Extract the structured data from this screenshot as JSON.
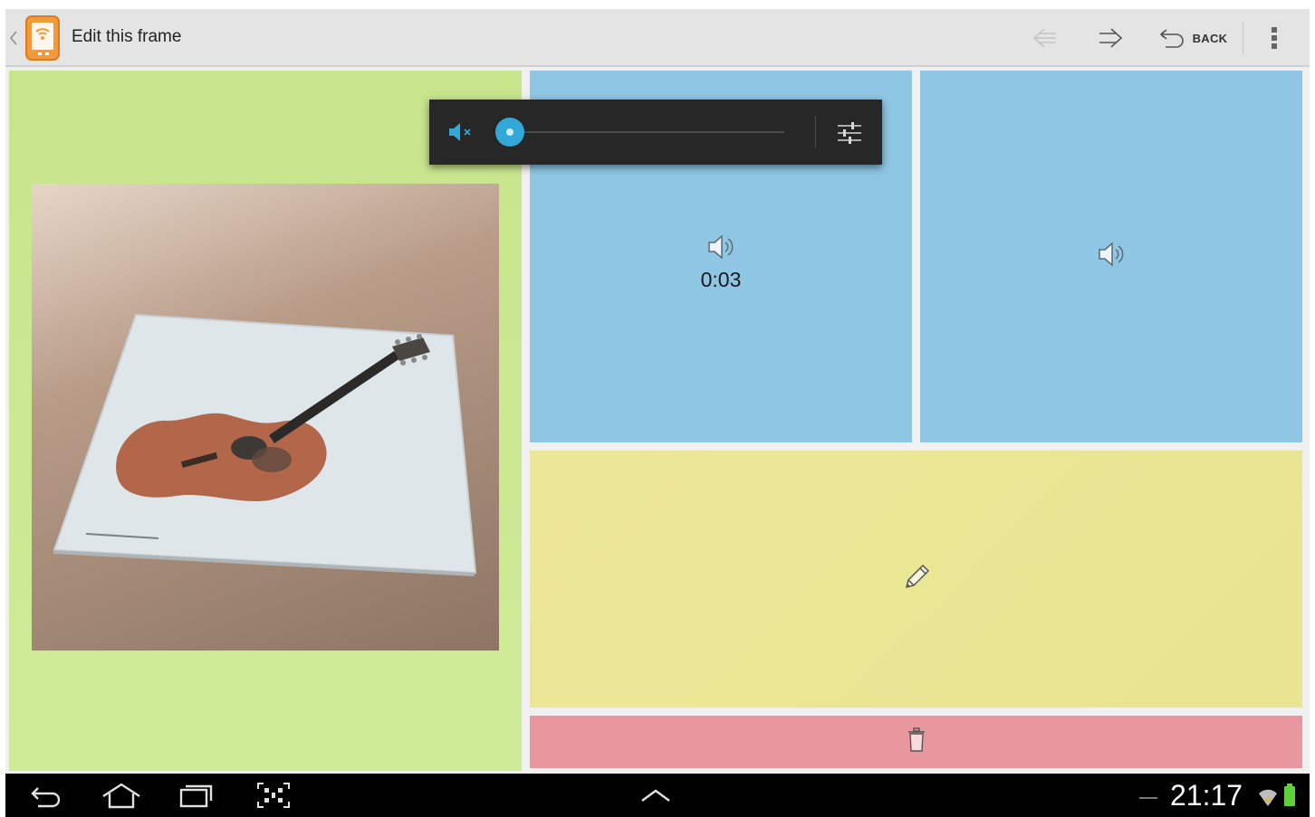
{
  "actionbar": {
    "title": "Edit this frame",
    "back_label": "BACK",
    "icons": [
      "up-caret-icon",
      "app-wifi-phone-icon",
      "arrow-left-icon",
      "arrow-right-icon",
      "undo-back-icon",
      "overflow-menu-icon"
    ]
  },
  "panels": {
    "image_panel": {
      "color": "#cce990",
      "icon": "guitar-photo"
    },
    "audio_panel_1": {
      "color": "#8ec6e4",
      "icon": "speaker-icon",
      "duration": "0:03"
    },
    "audio_panel_2": {
      "color": "#8ec6e4",
      "icon": "speaker-icon"
    },
    "text_panel": {
      "color": "#ebe695",
      "icon": "pencil-icon"
    },
    "delete_panel": {
      "color": "#e9979f",
      "icon": "trash-icon"
    }
  },
  "volume_popup": {
    "mute_icon": "speaker-muted-icon",
    "level_fraction": 0.0,
    "settings_icon": "equalizer-settings-icon",
    "accent": "#33a8d8"
  },
  "system_bar": {
    "clock": "21:17",
    "buttons": [
      "back-icon",
      "home-icon",
      "recent-apps-icon",
      "screenshot-icon",
      "expand-up-icon"
    ],
    "status_icons": [
      "wifi-icon",
      "battery-icon"
    ]
  }
}
